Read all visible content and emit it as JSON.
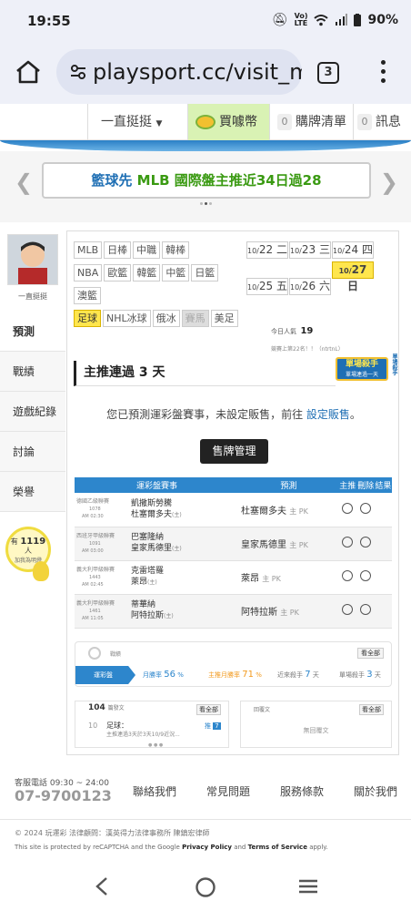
{
  "status": {
    "time": "19:55",
    "battery": "90%"
  },
  "browser": {
    "url": "playsport.cc/visit_m",
    "tab_count": "3"
  },
  "nav": {
    "item1": "一直挺挺",
    "buy_label": "買噱幣",
    "purchase_count": "0",
    "purchase_label": "購牌清單",
    "msg_count": "0",
    "msg_label": "訊息"
  },
  "banner": {
    "prefix": "籃球先",
    "text": "MLB 國際盤主推近34日過28"
  },
  "profile": {
    "name": "一直挺挺"
  },
  "sidebar": {
    "items": [
      {
        "label": "預測"
      },
      {
        "label": "戰績"
      },
      {
        "label": "遊戲紀錄"
      },
      {
        "label": "討論"
      },
      {
        "label": "榮譽"
      }
    ]
  },
  "fans": {
    "prefix": "有",
    "count": "1119",
    "suffix": "人",
    "line2": "加我為明燈"
  },
  "leagues": {
    "row1": [
      "MLB",
      "日棒",
      "中職",
      "韓棒"
    ],
    "row2": [
      "NBA",
      "歐籃",
      "韓籃",
      "中籃",
      "日籃"
    ],
    "row3": [
      "澳籃"
    ],
    "row4": [
      "足球",
      "NHL冰球",
      "俄冰",
      "賽馬",
      "美足"
    ]
  },
  "dates": {
    "row1": [
      {
        "m": "10/",
        "d": "22",
        "w": "二"
      },
      {
        "m": "10/",
        "d": "23",
        "w": "三"
      },
      {
        "m": "10/",
        "d": "24",
        "w": "四"
      }
    ],
    "row2": [
      {
        "m": "10/",
        "d": "25",
        "w": "五"
      },
      {
        "m": "10/",
        "d": "26",
        "w": "六"
      },
      {
        "m": "10/",
        "d": "27",
        "w": "日"
      }
    ]
  },
  "stats": {
    "popularity_label": "今日人氣",
    "popularity_value": "19",
    "rank_line": "競賽上第22名！！（ntrtnL）"
  },
  "section": {
    "title": "主推連過 3 天",
    "badge_line1": "單場殺手",
    "badge_line2": "單場連過一天",
    "badge_side": "單場殺手"
  },
  "notice": {
    "text": "您已預測運彩盤賽事，未設定販售，前往",
    "link": "設定販售",
    "end": "。"
  },
  "sell_button": "售牌管理",
  "table": {
    "headers": [
      "運彩盤賽事",
      "預測",
      "主推",
      "刪除",
      "結果"
    ],
    "rows": [
      {
        "league": "德國乙級聯賽",
        "num": "1078",
        "time": "AM 02:30",
        "team1": "凱撒斯勞騰",
        "team2": "杜塞爾多夫",
        "team2_tag": "(主)",
        "pick": "杜塞爾多夫",
        "pick_tag": "主 PK"
      },
      {
        "league": "西班牙甲級聯賽",
        "num": "1091",
        "time": "AM 03:00",
        "team1": "巴塞隆納",
        "team2": "皇家馬德里",
        "team2_tag": "(主)",
        "pick": "皇家馬德里",
        "pick_tag": "主 PK"
      },
      {
        "league": "義大利甲級聯賽",
        "num": "1443",
        "time": "AM 02:45",
        "team1": "克雷塔羅",
        "team2": "萊昂",
        "team2_tag": "(主)",
        "pick": "萊昂",
        "pick_tag": "主 PK"
      },
      {
        "league": "義大利甲級聯賽",
        "num": "1461",
        "time": "AM 11:05",
        "team1": "蒂華納",
        "team2": "阿特拉斯",
        "team2_tag": "(主)",
        "pick": "阿特拉斯",
        "pick_tag": "主 PK"
      }
    ]
  },
  "record": {
    "label": "戰績",
    "see_all": "看全部",
    "tab": "運彩盤",
    "stats": [
      {
        "label": "月勝率",
        "value": "56",
        "unit": "%"
      },
      {
        "label": "主推月勝率",
        "value": "71",
        "unit": "%"
      },
      {
        "label": "近來殺手",
        "value": "7",
        "unit": "天"
      },
      {
        "label": "單場殺手",
        "value": "3",
        "unit": "天"
      }
    ]
  },
  "posts": {
    "count": "104",
    "count_label": "篇發文",
    "see_all": "看全部",
    "item_num": "10",
    "item_title": "足球：",
    "item_sub": "主推連過3天於3天10/9近況...",
    "item_badge": "7"
  },
  "replies": {
    "label": "回覆文",
    "see_all": "看全部",
    "empty": "無回覆文"
  },
  "footer": {
    "phone_label": "客服電話 09:30 ~ 24:00",
    "phone": "07-9700123",
    "links": [
      "聯絡我們",
      "常見問題",
      "服務條款",
      "關於我們"
    ],
    "copyright": "© 2024 玩運彩 法律顧問：漢英得力法律事務所 陳鎮宏律師",
    "recaptcha_pre": "This site is protected by reCAPTCHA and the Google",
    "privacy": "Privacy Policy",
    "and": "and",
    "terms": "Terms of Service",
    "apply": "apply."
  }
}
